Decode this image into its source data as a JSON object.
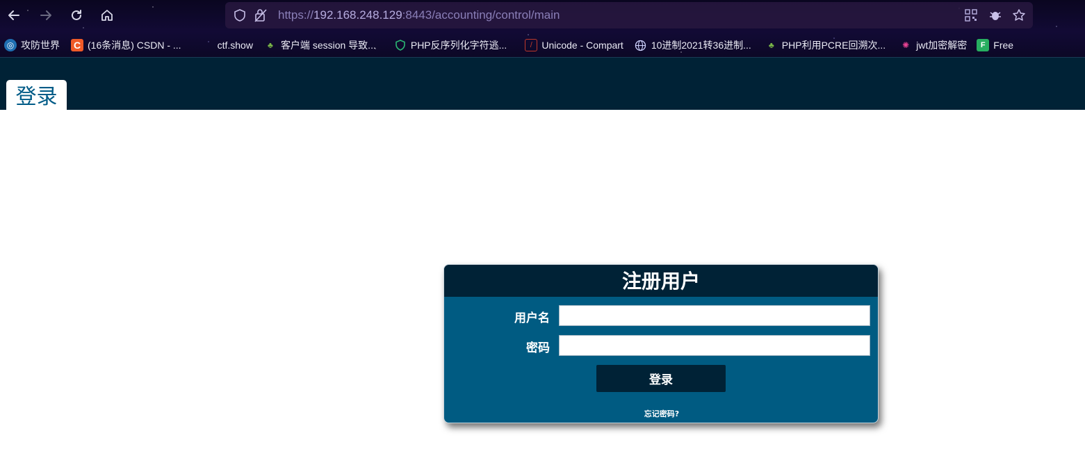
{
  "browser": {
    "url_prefix": "https://",
    "url_host": "192.168.248.129",
    "url_rest": ":8443/accounting/control/main",
    "bookmarks": [
      {
        "label": "攻防世界",
        "icon": "globe-blue-icon",
        "color": "#3b8fd6"
      },
      {
        "label": "(16条消息) CSDN - ...",
        "icon": "csdn-c-icon",
        "color": "#f05a28"
      },
      {
        "label": "ctf.show",
        "icon": "blank-icon",
        "color": ""
      },
      {
        "label": "客户端 session 导致...",
        "icon": "cactus-icon",
        "color": "#7ab648"
      },
      {
        "label": "PHP反序列化字符逃...",
        "icon": "shield-green-icon",
        "color": "#2bb673"
      },
      {
        "label": "Unicode - Compart",
        "icon": "compart-icon",
        "color": "#c0392b"
      },
      {
        "label": "10进制2021转36进制...",
        "icon": "globe-icon",
        "color": "#cfd3ff"
      },
      {
        "label": "PHP利用PCRE回溯次...",
        "icon": "cactus-icon",
        "color": "#7ab648"
      },
      {
        "label": "jwt加密解密",
        "icon": "pinwheel-icon",
        "color": "#e84393"
      },
      {
        "label": "Free",
        "icon": "freebuf-icon",
        "color": "#27ae60"
      }
    ]
  },
  "app": {
    "tab_label": "登录"
  },
  "login": {
    "title": "注册用户",
    "username_label": "用户名",
    "username_value": "",
    "password_label": "密码",
    "password_value": "",
    "submit_label": "登录",
    "forgot_label": "忘记密码?"
  }
}
